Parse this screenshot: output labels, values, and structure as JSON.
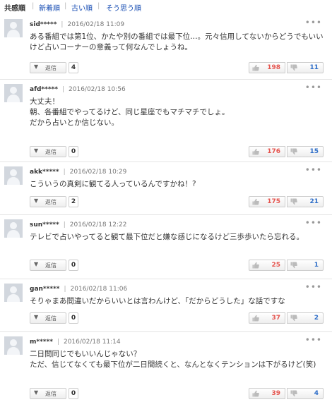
{
  "tabs": [
    {
      "label": "共感順"
    },
    {
      "label": "新着順"
    },
    {
      "label": "古い順"
    },
    {
      "label": "そう思う順"
    }
  ],
  "comments": [
    {
      "user": "sid*****",
      "date": "2016/02/18 11:09",
      "text": "ある番組では第1位、かたや別の番組では最下位…。元々信用してないからどうでもいいけど占いコーナーの意義って何なんでしょうね。",
      "reply_label": "返信",
      "replies": "4",
      "likes": "198",
      "dislikes": "11"
    },
    {
      "user": "afd*****",
      "date": "2016/02/18 10:56",
      "text": "大丈夫！\n朝、各番組でやってるけど、同じ星座でもマチマチでしょ。\nだから占いとか信じない。",
      "reply_label": "返信",
      "replies": "0",
      "likes": "176",
      "dislikes": "15"
    },
    {
      "user": "akk*****",
      "date": "2016/02/18 10:29",
      "text": "こういうの真剣に観てる人っているんですかね！?",
      "reply_label": "返信",
      "replies": "2",
      "likes": "175",
      "dislikes": "21"
    },
    {
      "user": "sun*****",
      "date": "2016/02/18 12:22",
      "text": "テレビで占いやってると観て最下位だと嫌な感じになるけど三歩歩いたら忘れる。",
      "reply_label": "返信",
      "replies": "0",
      "likes": "25",
      "dislikes": "1"
    },
    {
      "user": "gan*****",
      "date": "2016/02/18 11:06",
      "text": "そりゃまあ間違いだからいいとは言わんけど、「だからどうした」な話ですな",
      "reply_label": "返信",
      "replies": "0",
      "likes": "37",
      "dislikes": "2"
    },
    {
      "user": "m*****",
      "date": "2016/02/18 11:14",
      "text": "二日間同じでもいいんじゃない？\nただ、信じてなくても最下位が二日間続くと、なんとなくテンションは下がるけど(笑)",
      "reply_label": "返信",
      "replies": "0",
      "likes": "39",
      "dislikes": "4"
    }
  ],
  "icons": {
    "avatar": "default-user-avatar",
    "more": "more-options-icon",
    "like": "thumbs-up-icon",
    "dislike": "thumbs-down-icon",
    "reply_caret": "chevron-down-icon"
  },
  "colors": {
    "link": "#1a4fb4",
    "like_count": "#e5554f",
    "dislike_count": "#2f6ec8"
  }
}
